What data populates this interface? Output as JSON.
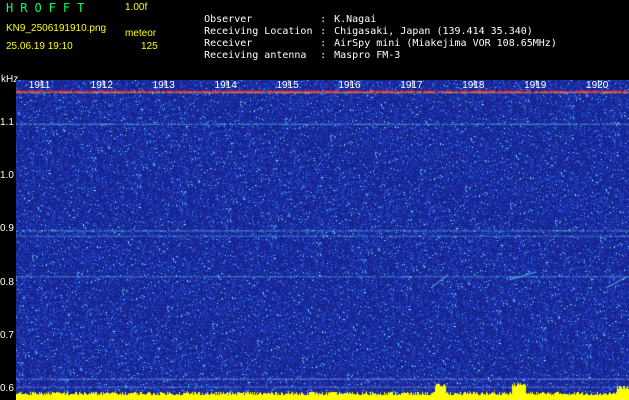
{
  "header": {
    "app_title": "HROFFT",
    "version": "1.00f",
    "filename": "KN9_2506191910.png",
    "meteor_label": "meteor",
    "datetime": "25.06.19 19:10",
    "meteor_count": "125"
  },
  "info": [
    {
      "key": "Observer",
      "value": "K.Nagai"
    },
    {
      "key": "Receiving Location",
      "value": "Chigasaki, Japan (139.414 35.340)"
    },
    {
      "key": "Receiver",
      "value": "AirSpy mini (Miakejima VOR 108.65MHz)"
    },
    {
      "key": "Receiving antenna",
      "value": "Maspro FM-3"
    }
  ],
  "separator": ":",
  "chart_data": {
    "type": "heatmap",
    "ylabel": "kHz",
    "y_ticks": [
      "1.1",
      "1.0",
      "0.9",
      "0.8",
      "0.7",
      "0.6"
    ],
    "y_tick_values": [
      1.1,
      1.0,
      0.9,
      0.8,
      0.7,
      0.6
    ],
    "x_ticks": [
      "1911",
      "1912",
      "1913",
      "1914",
      "1915",
      "1916",
      "1917",
      "1918",
      "1919",
      "1920"
    ],
    "ylim": [
      0.58,
      1.18
    ],
    "xlim": [
      1910.6,
      1920.5
    ],
    "colors": {
      "background": "#1a2a8c",
      "noise": "#3a5aff",
      "echo": "#7cf0ff",
      "strong": "#ff2a2a",
      "bottom_bar": "#ffff00"
    }
  }
}
